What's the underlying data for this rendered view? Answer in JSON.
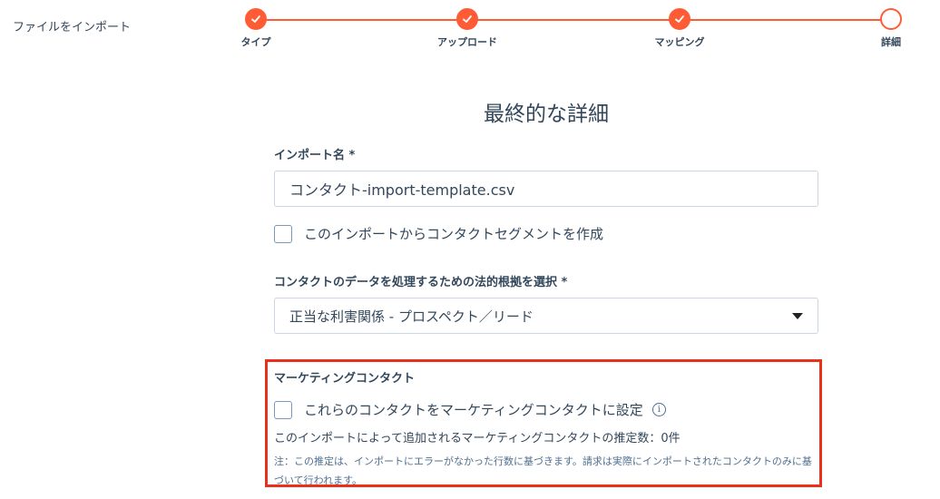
{
  "header": {
    "title": "ファイルをインポート"
  },
  "stepper": {
    "steps": [
      {
        "label": "タイプ",
        "state": "complete"
      },
      {
        "label": "アップロード",
        "state": "complete"
      },
      {
        "label": "マッピング",
        "state": "complete"
      },
      {
        "label": "詳細",
        "state": "current"
      }
    ],
    "accent_color": "#ff5c35"
  },
  "main": {
    "title": "最終的な詳細",
    "import_name": {
      "label": "インポート名 *",
      "value": "コンタクト-import-template.csv"
    },
    "segment_checkbox": {
      "label": "このインポートからコンタクトセグメントを作成",
      "checked": false
    },
    "legal_basis": {
      "label": "コンタクトのデータを処理するための法的根拠を選択 *",
      "selected": "正当な利害関係 - プロスペクト／リード"
    },
    "marketing": {
      "heading": "マーケティングコンタクト",
      "checkbox_label": "これらのコンタクトをマーケティングコンタクトに設定",
      "checked": false,
      "info_icon": "i",
      "estimate": "このインポートによって追加されるマーケティングコンタクトの推定数：0件",
      "note": "注：この推定は、インポートにエラーがなかった行数に基づきます。請求は実際にインポートされたコンタクトのみに基づいて行われます。"
    }
  }
}
